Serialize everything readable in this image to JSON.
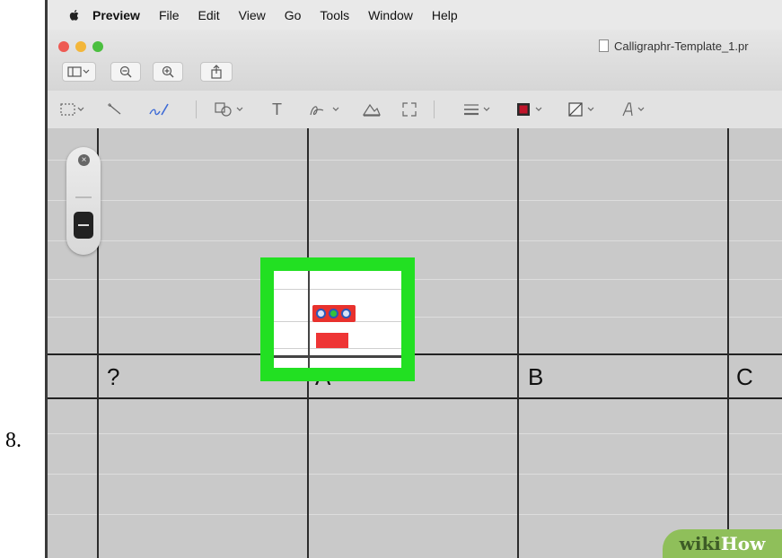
{
  "step": {
    "number": "8."
  },
  "menubar": {
    "apple_icon": "apple-logo-icon",
    "items": [
      "Preview",
      "File",
      "Edit",
      "View",
      "Go",
      "Tools",
      "Window",
      "Help"
    ]
  },
  "window": {
    "title": "Calligraphr-Template_1.pr",
    "toolbar": {
      "buttons": [
        "sidebar-toggle-icon",
        "zoom-out-icon",
        "zoom-in-icon",
        "share-icon"
      ]
    },
    "markup_toolbar": {
      "tools": [
        "rectangular-selection-icon",
        "instant-alpha-icon",
        "sketch-icon",
        "shapes-icon",
        "text-icon",
        "sign-icon",
        "adjust-color-icon",
        "adjust-size-icon",
        "shape-style-icon",
        "border-color-icon",
        "fill-color-icon",
        "text-style-icon"
      ],
      "text_tool_label": "T"
    }
  },
  "document": {
    "cells": [
      {
        "label": "?"
      },
      {
        "label": "A"
      },
      {
        "label": "B"
      },
      {
        "label": "C"
      }
    ]
  },
  "colors": {
    "highlight": "#22e022",
    "border_swatch": "#c0142a",
    "watermark_bg": "#8fbf5a"
  },
  "watermark": {
    "part1": "wiki",
    "part2": "How"
  }
}
